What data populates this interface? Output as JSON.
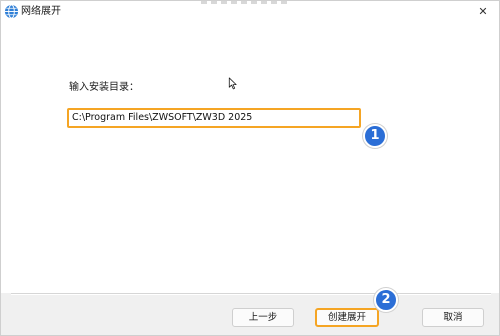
{
  "window": {
    "title": "网络展开"
  },
  "main": {
    "prompt_label": "输入安装目录：",
    "install_path": {
      "value": "C:\\Program Files\\ZWSOFT\\ZW3D 2025"
    }
  },
  "annotations": {
    "step1": "1",
    "step2": "2"
  },
  "footer": {
    "prev_label": "上一步",
    "create_label": "创建展开",
    "cancel_label": "取消"
  },
  "colors": {
    "highlight": "#f5a524",
    "badge": "#2b6ed6"
  },
  "icons": {
    "app": "globe-icon",
    "close": "close-icon",
    "cursor": "mouse-cursor-icon"
  }
}
